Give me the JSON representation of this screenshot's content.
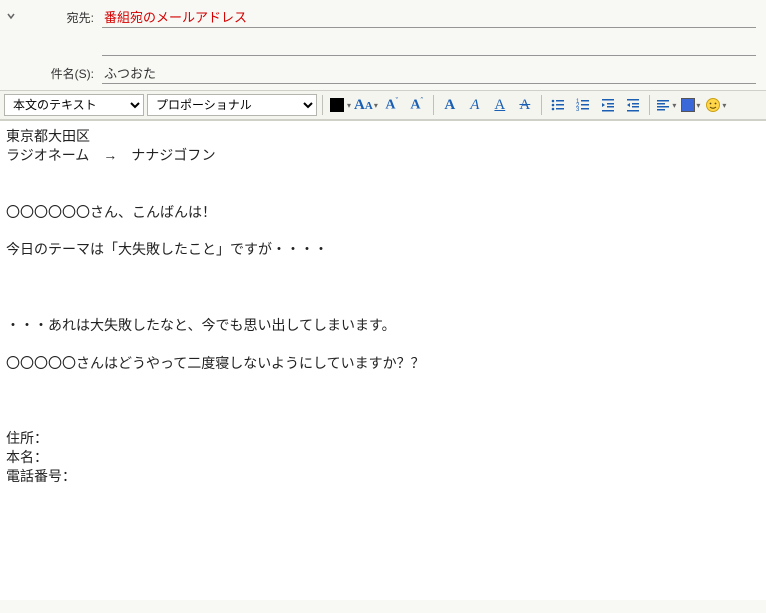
{
  "header": {
    "to_label": "宛先:",
    "to_value": "番組宛のメールアドレス",
    "subject_label": "件名(S):",
    "subject_value": "ふつおた"
  },
  "toolbar": {
    "format_selected": "本文のテキスト",
    "font_selected": "プロポーショナル"
  },
  "body_lines": [
    "東京都大田区",
    "ラジオネーム　→　ナナジゴフン",
    "",
    "",
    "〇〇〇〇〇〇さん、こんばんは！",
    "",
    "今日のテーマは「大失敗したこと」ですが・・・・",
    "",
    "",
    "",
    "・・・あれは大失敗したなと、今でも思い出してしまいます。",
    "",
    "〇〇〇〇〇さんはどうやって二度寝しないようにしていますか？？",
    "",
    "",
    "",
    "住所：",
    "本名：",
    "電話番号："
  ]
}
